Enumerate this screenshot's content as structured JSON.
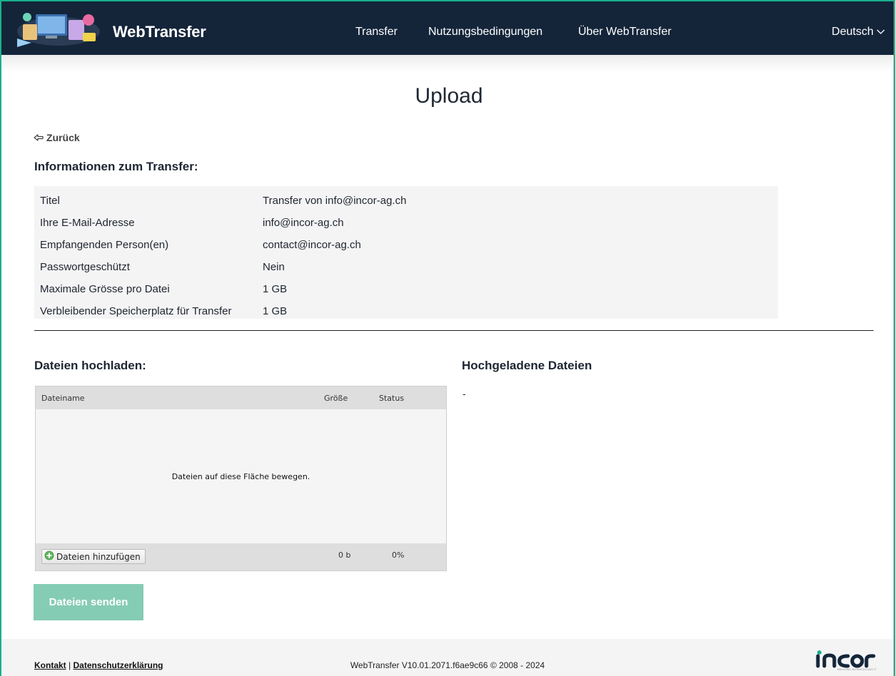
{
  "header": {
    "brand": "WebTransfer",
    "nav": [
      "Transfer",
      "Nutzungsbedingungen",
      "Über WebTransfer"
    ],
    "language": "Deutsch"
  },
  "page": {
    "title": "Upload",
    "back_label": "Zurück"
  },
  "info": {
    "heading": "Informationen zum Transfer:",
    "rows": [
      {
        "label": "Titel",
        "value": "Transfer von info@incor-ag.ch"
      },
      {
        "label": "Ihre E-Mail-Adresse",
        "value": "info@incor-ag.ch"
      },
      {
        "label": "Empfangenden Person(en)",
        "value": "contact@incor-ag.ch"
      },
      {
        "label": "Passwortgeschützt",
        "value": "Nein"
      },
      {
        "label": "Maximale Grösse pro Datei",
        "value": "1 GB"
      },
      {
        "label": "Verbleibender Speicherplatz für Transfer",
        "value": "1 GB"
      }
    ]
  },
  "upload": {
    "heading": "Dateien hochladen:",
    "col_name": "Dateiname",
    "col_size": "Größe",
    "col_status": "Status",
    "drop_hint": "Dateien auf diese Fläche bewegen.",
    "add_button": "Dateien hinzufügen",
    "total_size": "0 b",
    "total_percent": "0%",
    "send_button": "Dateien senden"
  },
  "uploaded": {
    "heading": "Hochgeladene Dateien",
    "empty": "-"
  },
  "footer": {
    "contact": "Kontakt",
    "separator": "|",
    "privacy": "Datenschutzerklärung",
    "version": "WebTransfer V10.01.2071.f6ae9c66 © 2008 - 2024",
    "logo_tagline": "BRIDGING BUSINESS AND IT"
  },
  "colors": {
    "header_bg": "#14253a",
    "accent": "#19b08b",
    "send_button_disabled": "#7fcab2"
  }
}
